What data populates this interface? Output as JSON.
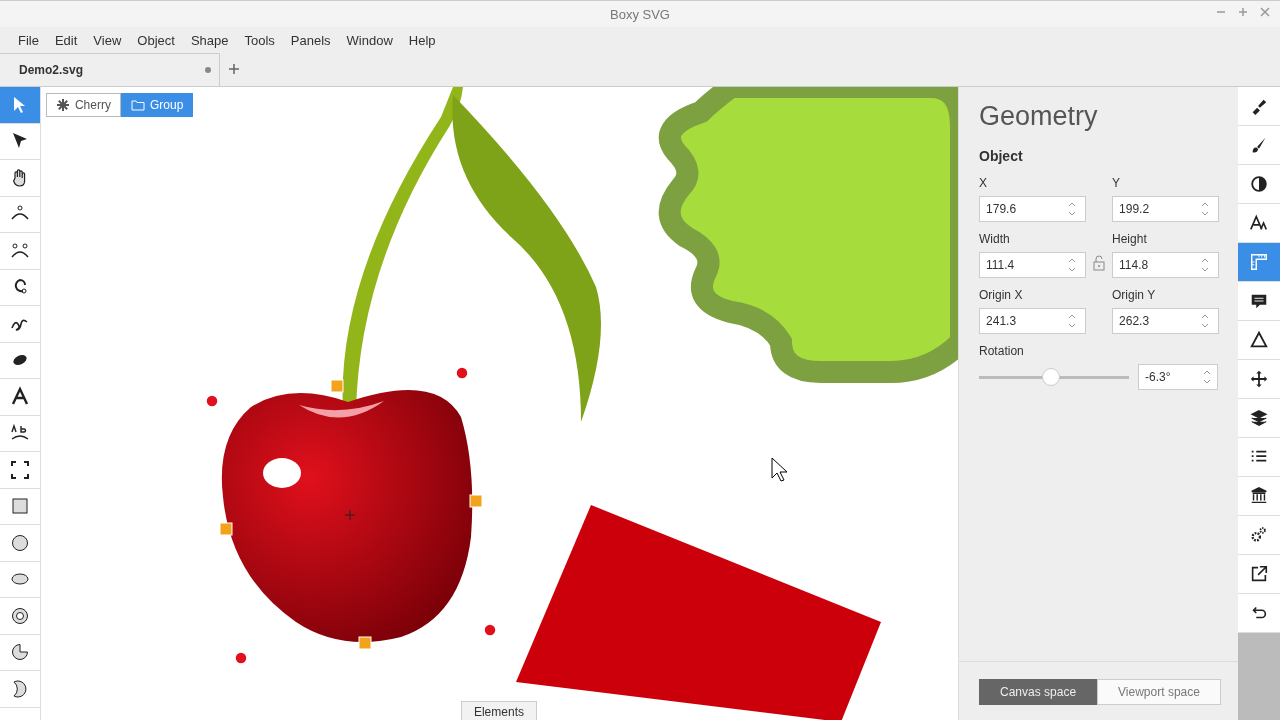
{
  "window": {
    "title": "Boxy SVG"
  },
  "menu": [
    "File",
    "Edit",
    "View",
    "Object",
    "Shape",
    "Tools",
    "Panels",
    "Window",
    "Help"
  ],
  "document_tabs": [
    {
      "label": "Demo2.svg",
      "selected": true,
      "unsaved": true
    }
  ],
  "tools": [
    {
      "selected": true
    },
    {
      "selected": false
    },
    {
      "selected": false
    },
    {
      "selected": false
    },
    {
      "selected": false
    },
    {
      "selected": false
    },
    {
      "selected": false
    },
    {
      "selected": false
    },
    {
      "selected": false
    },
    {
      "selected": false
    },
    {
      "selected": false
    },
    {
      "selected": false
    },
    {
      "selected": false
    },
    {
      "selected": false
    },
    {
      "selected": false
    },
    {
      "selected": false
    },
    {
      "selected": false
    }
  ],
  "breadcrumb": [
    {
      "label": "Cherry",
      "kind": "element",
      "selected": false
    },
    {
      "label": "Group",
      "kind": "group",
      "selected": true
    }
  ],
  "canvas": {
    "bottom_tab": "Elements"
  },
  "panel": {
    "title": "Geometry",
    "section": "Object",
    "fields": [
      {
        "label": "X",
        "value": "179.6"
      },
      {
        "label": "Y",
        "value": "199.2"
      },
      {
        "label": "Width",
        "value": "111.4"
      },
      {
        "label": "Height",
        "value": "114.8"
      },
      {
        "label": "Origin X",
        "value": "241.3"
      },
      {
        "label": "Origin Y",
        "value": "262.3"
      }
    ],
    "rotation": {
      "label": "Rotation",
      "level": 0.48,
      "value": "-6.3°"
    },
    "spaces": [
      {
        "label": "Canvas space",
        "selected": true
      },
      {
        "label": "Viewport space",
        "selected": false
      }
    ]
  },
  "panel_tabs": [
    {
      "selected": false
    },
    {
      "selected": false
    },
    {
      "selected": false
    },
    {
      "selected": false
    },
    {
      "selected": true
    },
    {
      "selected": false
    },
    {
      "selected": false
    },
    {
      "selected": false
    },
    {
      "selected": false
    },
    {
      "selected": false
    },
    {
      "selected": false
    },
    {
      "selected": false
    },
    {
      "selected": false
    },
    {
      "selected": false
    }
  ]
}
